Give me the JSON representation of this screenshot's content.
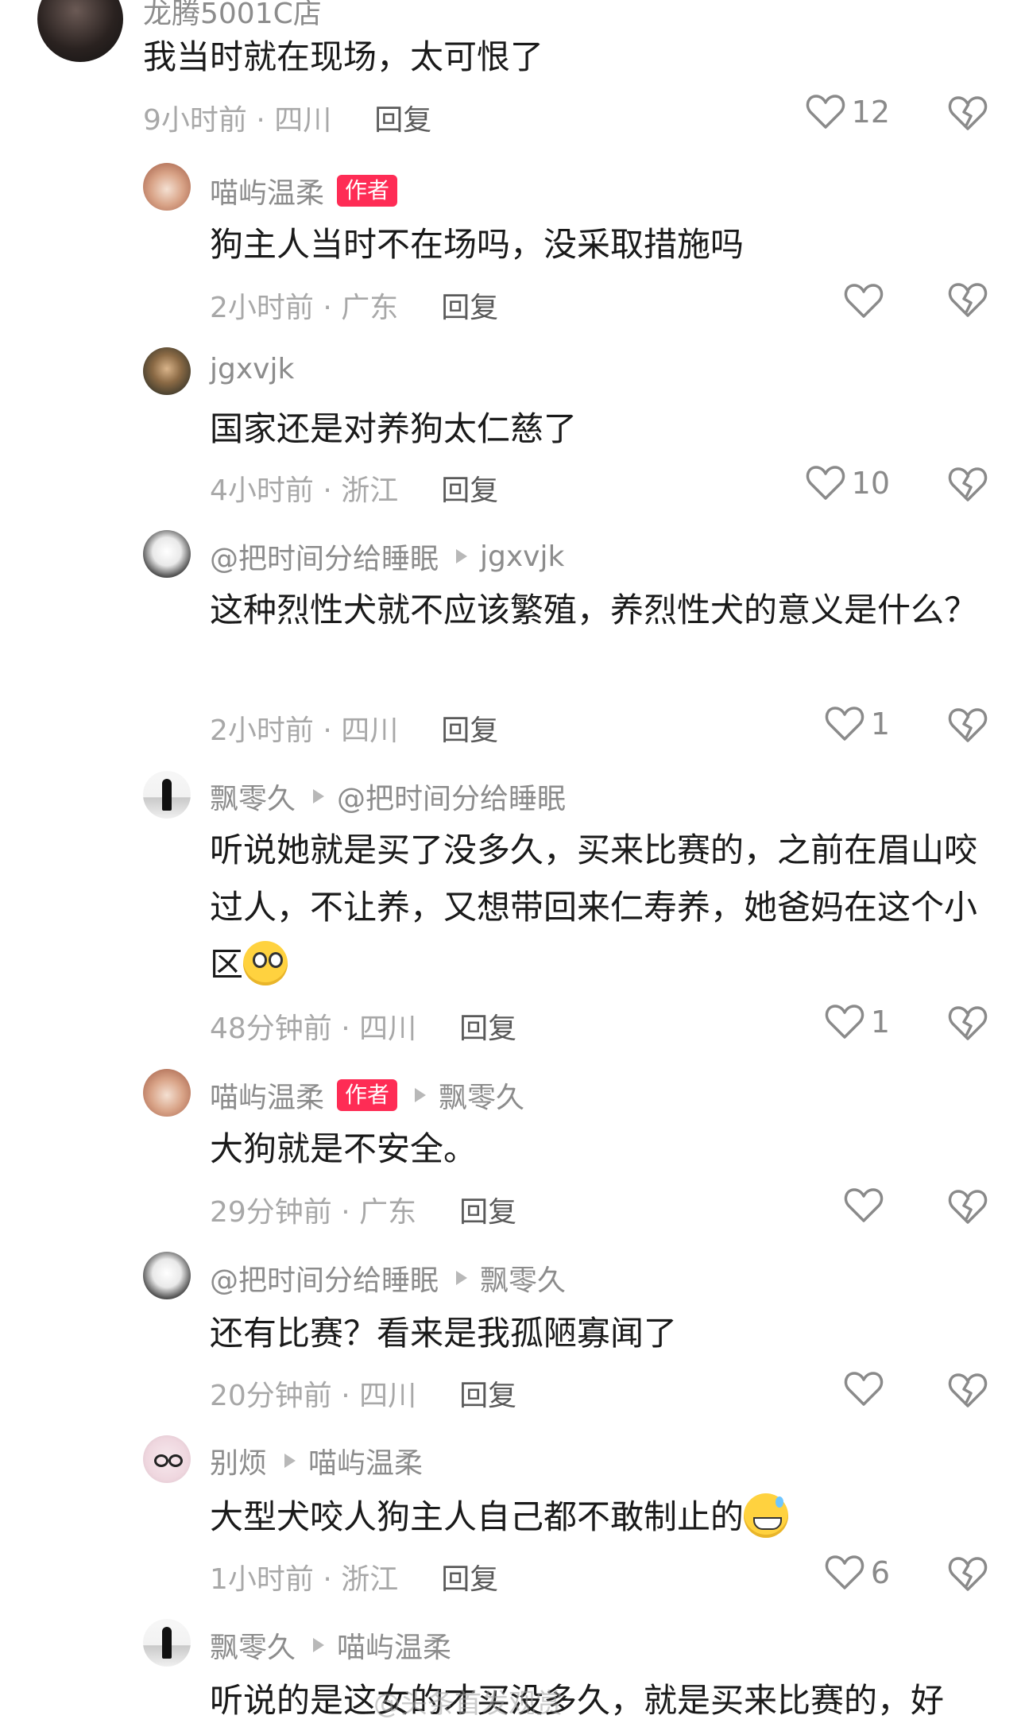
{
  "comments": [
    {
      "name": "龙腾5001C店",
      "badge": "",
      "target": "",
      "text": "我当时就在现场，太可恨了",
      "time": "9小时前 · 四川",
      "reply": "回复",
      "likes": "12",
      "dislike_icon": "broken-heart"
    },
    {
      "name": "喵屿温柔",
      "badge": "作者",
      "target": "",
      "text": "狗主人当时不在场吗，没采取措施吗",
      "time": "2小时前 · 广东",
      "reply": "回复",
      "likes": ""
    },
    {
      "name": "jgxvjk",
      "badge": "",
      "target": "",
      "text": "国家还是对养狗太仁慈了",
      "time": "4小时前 · 浙江",
      "reply": "回复",
      "likes": "10"
    },
    {
      "name": "@把时间分给睡眠",
      "badge": "",
      "target": "jgxvjk",
      "text": "这种烈性犬就不应该繁殖，养烈性犬的意义是什么？",
      "time": "2小时前 · 四川",
      "reply": "回复",
      "likes": "1"
    },
    {
      "name": "飘零久",
      "badge": "",
      "target": "@把时间分给睡眠",
      "text": "听说她就是买了没多久，买来比赛的，之前在眉山咬过人，不让养，又想带回来仁寿养，她爸妈在这个小区",
      "time": "48分钟前 · 四川",
      "reply": "回复",
      "likes": "1"
    },
    {
      "name": "喵屿温柔",
      "badge": "作者",
      "target": "飘零久",
      "text": "大狗就是不安全。",
      "time": "29分钟前 · 广东",
      "reply": "回复",
      "likes": ""
    },
    {
      "name": "@把时间分给睡眠",
      "badge": "",
      "target": "飘零久",
      "text": "还有比赛？看来是我孤陋寡闻了",
      "time": "20分钟前 · 四川",
      "reply": "回复",
      "likes": ""
    },
    {
      "name": "别烦",
      "badge": "",
      "target": "喵屿温柔",
      "text": "大型犬咬人狗主人自己都不敢制止的",
      "time": "1小时前 · 浙江",
      "reply": "回复",
      "likes": "6"
    },
    {
      "name": "飘零久",
      "badge": "",
      "target": "喵屿温柔",
      "text": "听说的是这女的才买没多久，就是买来比赛的，好",
      "time": "",
      "reply": "",
      "likes": ""
    }
  ],
  "watermark": "@头条首发观赏",
  "colors": {
    "badge": "#fe2c55",
    "text": "#1a1a1a",
    "meta": "#a8a8a8",
    "name": "#8c8c8c"
  }
}
